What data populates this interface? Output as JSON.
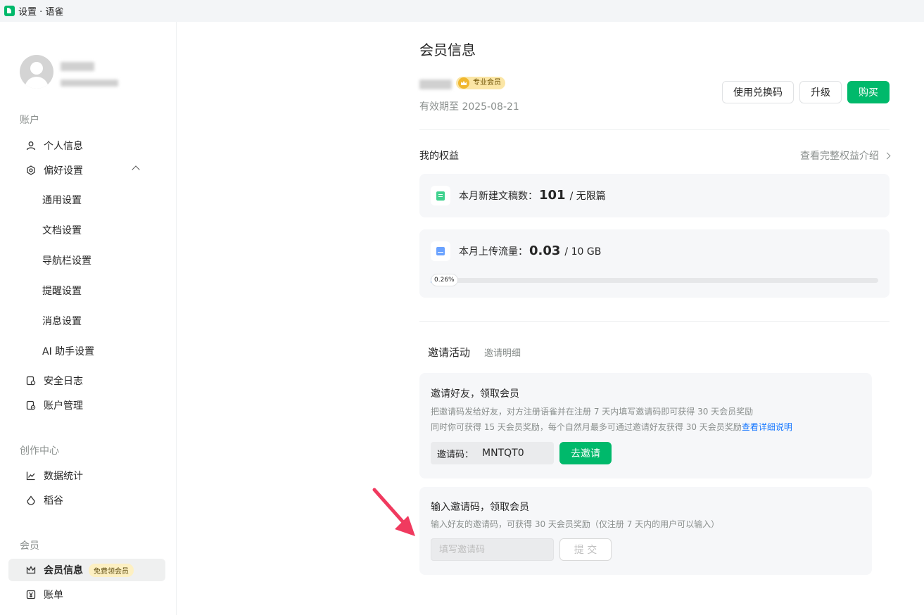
{
  "window": {
    "title": "设置 · 语雀"
  },
  "sidebar": {
    "sections": {
      "account": "账户",
      "creator": "创作中心",
      "member": "会员"
    },
    "items": {
      "profile": "个人信息",
      "preferences": "偏好设置",
      "general": "通用设置",
      "documents": "文档设置",
      "navbar": "导航栏设置",
      "reminders": "提醒设置",
      "messages": "消息设置",
      "ai_assistant": "AI 助手设置",
      "security_log": "安全日志",
      "account_mgmt": "账户管理",
      "statistics": "数据统计",
      "rice": "稻谷",
      "membership": "会员信息",
      "membership_badge": "免费领会员",
      "billing": "账单"
    }
  },
  "main": {
    "title": "会员信息",
    "member_badge": "专业会员",
    "expiry": "有效期至 2025-08-21",
    "buttons": {
      "redeem": "使用兑换码",
      "upgrade": "升级",
      "buy": "购买"
    },
    "rights": {
      "title": "我的权益",
      "link": "查看完整权益介绍",
      "docs": {
        "label": "本月新建文稿数：",
        "value": "101",
        "limit": "/ 无限篇"
      },
      "upload": {
        "label": "本月上传流量：",
        "value": "0.03",
        "limit": "/ 10 GB",
        "percent_label": "0.26%",
        "percent": 0.26
      }
    },
    "invite": {
      "tabs": {
        "activity": "邀请活动",
        "details": "邀请明细"
      },
      "card1": {
        "title": "邀请好友，领取会员",
        "desc1": "把邀请码发给好友，对方注册语雀并在注册 7 天内填写邀请码即可获得 30 天会员奖励",
        "desc2": "同时你可获得 15 天会员奖励，每个自然月最多可通过邀请好友获得 30 天会员奖励",
        "link": "查看详细说明",
        "code_label": "邀请码：",
        "code_value": "MNTQT0",
        "button": "去邀请"
      },
      "card2": {
        "title": "输入邀请码，领取会员",
        "desc": "输入好友的邀请码，可获得 30 天会员奖励（仅注册 7 天内的用户可以输入）",
        "placeholder": "填写邀请码",
        "button": "提 交"
      }
    }
  },
  "colors": {
    "brand_green": "#00b96b",
    "link_blue": "#1677ff",
    "arrow_red": "#f03a5f"
  }
}
